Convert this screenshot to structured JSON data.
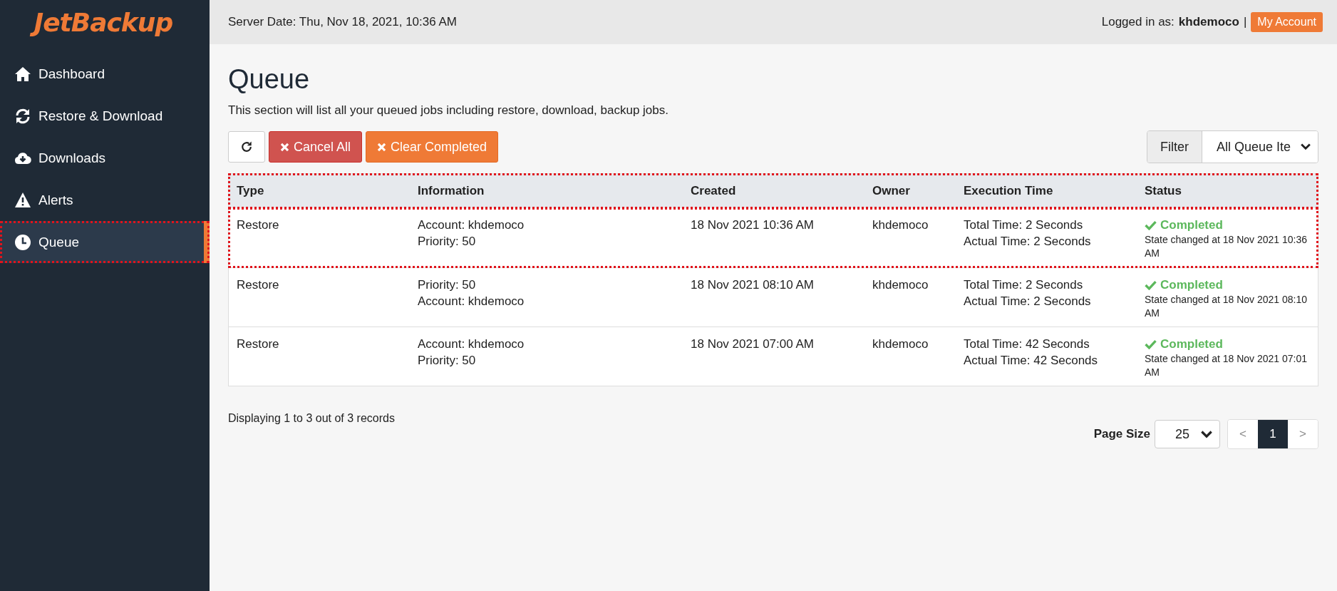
{
  "logo": "JetBackup",
  "sidebar": {
    "items": [
      {
        "label": "Dashboard",
        "kind": "home",
        "selected": false,
        "highlighted": false
      },
      {
        "label": "Restore & Download",
        "kind": "sync",
        "selected": false,
        "highlighted": false
      },
      {
        "label": "Downloads",
        "kind": "cloud",
        "selected": false,
        "highlighted": false
      },
      {
        "label": "Alerts",
        "kind": "warning",
        "selected": false,
        "highlighted": false
      },
      {
        "label": "Queue",
        "kind": "clock",
        "selected": true,
        "highlighted": true
      }
    ]
  },
  "topbar": {
    "server_date": "Server Date: Thu, Nov 18, 2021, 10:36 AM",
    "logged_in_label": "Logged in as:",
    "username": "khdemoco",
    "separator": "|",
    "account_button": "My Account"
  },
  "page": {
    "title": "Queue",
    "description": "This section will list all your queued jobs including restore, download, backup jobs."
  },
  "toolbar": {
    "cancel_all": "Cancel All",
    "clear_completed": "Clear Completed",
    "filter_label": "Filter",
    "filter_value": "All Queue Ite"
  },
  "table": {
    "highlight_header": true,
    "columns": [
      "Type",
      "Information",
      "Created",
      "Owner",
      "Execution Time",
      "Status"
    ],
    "rows": [
      {
        "type": "Restore",
        "information": [
          "Account: khdemoco",
          "Priority: 50"
        ],
        "created": "18 Nov 2021 10:36 AM",
        "owner": "khdemoco",
        "execution": [
          "Total Time: 2 Seconds",
          "Actual Time: 2 Seconds"
        ],
        "status": "Completed",
        "kind": "success",
        "state_changed": "State changed at 18 Nov 2021 10:36 AM",
        "highlighted": true
      },
      {
        "type": "Restore",
        "information": [
          "Priority: 50",
          "Account: khdemoco"
        ],
        "created": "18 Nov 2021 08:10 AM",
        "owner": "khdemoco",
        "execution": [
          "Total Time: 2 Seconds",
          "Actual Time: 2 Seconds"
        ],
        "status": "Completed",
        "kind": "success",
        "state_changed": "State changed at 18 Nov 2021 08:10 AM",
        "highlighted": false
      },
      {
        "type": "Restore",
        "information": [
          "Account: khdemoco",
          "Priority: 50"
        ],
        "created": "18 Nov 2021 07:00 AM",
        "owner": "khdemoco",
        "execution": [
          "Total Time: 42 Seconds",
          "Actual Time: 42 Seconds"
        ],
        "status": "Completed",
        "kind": "success",
        "state_changed": "State changed at 18 Nov 2021 07:01 AM",
        "highlighted": false
      }
    ]
  },
  "footer": {
    "records": "Displaying 1 to 3 out of 3 records",
    "page_size_label": "Page Size",
    "page_size": "25",
    "prev": "<",
    "pages": [
      {
        "label": "1",
        "selected": true
      }
    ],
    "next": ">"
  }
}
